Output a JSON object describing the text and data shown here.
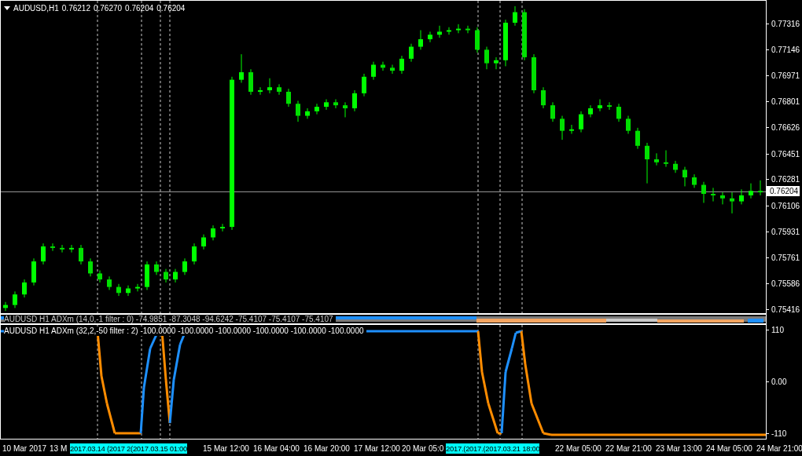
{
  "header": {
    "symbol": "AUDUSD,H1",
    "quotes": [
      "0.76212",
      "0.76270",
      "0.76204",
      "0.76204"
    ]
  },
  "price_chart": {
    "chart_data": {
      "type": "candlestick",
      "ylim": [
        0.75385,
        0.77476
      ],
      "ref_lines": [
        {
          "axis": "y",
          "value": 0.76204,
          "label": "0.76204"
        }
      ],
      "yticks": [
        {
          "value": 0.77316,
          "label": "0.77316"
        },
        {
          "value": 0.77146,
          "label": "0.77146"
        },
        {
          "value": 0.76971,
          "label": "0.76971"
        },
        {
          "value": 0.76801,
          "label": "0.76801"
        },
        {
          "value": 0.76626,
          "label": "0.76626"
        },
        {
          "value": 0.76451,
          "label": "0.76451"
        },
        {
          "value": 0.76281,
          "label": "0.76281"
        },
        {
          "value": 0.76106,
          "label": "0.76106"
        },
        {
          "value": 0.75931,
          "label": "0.75931"
        },
        {
          "value": 0.75761,
          "label": "0.75761"
        },
        {
          "value": 0.75586,
          "label": "0.75586"
        },
        {
          "value": 0.75416,
          "label": "0.75416"
        }
      ],
      "categories": [
        null,
        null,
        null,
        null,
        null,
        null,
        null,
        null,
        null,
        null,
        null,
        null,
        null,
        null,
        null,
        null,
        null,
        null,
        null,
        null,
        null,
        null,
        null,
        null,
        null,
        null,
        null,
        null,
        null,
        null,
        null,
        null,
        null,
        null,
        null,
        null,
        null,
        null,
        null,
        null,
        null,
        null,
        null,
        null,
        null,
        null,
        null,
        null,
        null,
        null,
        null,
        null,
        null,
        null,
        null,
        null,
        null,
        null,
        null,
        null,
        null,
        null,
        null,
        null,
        null,
        null,
        null,
        null,
        null,
        null,
        null,
        null,
        null,
        null,
        null,
        null,
        null,
        null,
        null,
        null,
        null
      ],
      "ohlc": [
        [
          0.7543,
          0.7547,
          0.7541,
          0.7545
        ],
        [
          0.7545,
          0.7554,
          0.7543,
          0.7552
        ],
        [
          0.7552,
          0.7562,
          0.755,
          0.756
        ],
        [
          0.756,
          0.7576,
          0.7558,
          0.7574
        ],
        [
          0.7574,
          0.7586,
          0.7572,
          0.7584
        ],
        [
          0.7584,
          0.7586,
          0.7581,
          0.7583
        ],
        [
          0.7583,
          0.7585,
          0.758,
          0.7582
        ],
        [
          0.7582,
          0.7585,
          0.758,
          0.7583
        ],
        [
          0.7583,
          0.7585,
          0.7572,
          0.7574
        ],
        [
          0.7574,
          0.7576,
          0.7564,
          0.7566
        ],
        [
          0.7566,
          0.7568,
          0.756,
          0.7562
        ],
        [
          0.7562,
          0.7564,
          0.7555,
          0.7557
        ],
        [
          0.7557,
          0.7559,
          0.7551,
          0.7553
        ],
        [
          0.7553,
          0.7558,
          0.7551,
          0.7556
        ],
        [
          0.7556,
          0.7559,
          0.7554,
          0.7557
        ],
        [
          0.7557,
          0.7574,
          0.7555,
          0.7572
        ],
        [
          0.7572,
          0.7574,
          0.7565,
          0.7567
        ],
        [
          0.7567,
          0.7569,
          0.756,
          0.7562
        ],
        [
          0.7562,
          0.7569,
          0.756,
          0.7567
        ],
        [
          0.7567,
          0.7576,
          0.7565,
          0.7574
        ],
        [
          0.7574,
          0.7586,
          0.7572,
          0.7584
        ],
        [
          0.7584,
          0.7592,
          0.7582,
          0.759
        ],
        [
          0.759,
          0.7598,
          0.7588,
          0.7596
        ],
        [
          0.7596,
          0.7599,
          0.7594,
          0.7597
        ],
        [
          0.7597,
          0.7697,
          0.7595,
          0.7695
        ],
        [
          0.7695,
          0.7712,
          0.7693,
          0.77
        ],
        [
          0.77,
          0.7702,
          0.7685,
          0.7687
        ],
        [
          0.7687,
          0.769,
          0.7685,
          0.7688
        ],
        [
          0.7688,
          0.7696,
          0.7686,
          0.769
        ],
        [
          0.769,
          0.7692,
          0.7685,
          0.7687
        ],
        [
          0.7687,
          0.7689,
          0.7677,
          0.7679
        ],
        [
          0.7679,
          0.7681,
          0.7667,
          0.7671
        ],
        [
          0.7671,
          0.7676,
          0.7669,
          0.7674
        ],
        [
          0.7674,
          0.7679,
          0.7672,
          0.7677
        ],
        [
          0.7677,
          0.7682,
          0.7675,
          0.768
        ],
        [
          0.768,
          0.7682,
          0.7676,
          0.7678
        ],
        [
          0.7678,
          0.768,
          0.767,
          0.7676
        ],
        [
          0.7676,
          0.7688,
          0.7674,
          0.7686
        ],
        [
          0.7686,
          0.7699,
          0.7684,
          0.7697
        ],
        [
          0.7697,
          0.7707,
          0.7695,
          0.7705
        ],
        [
          0.7705,
          0.7707,
          0.7701,
          0.7703
        ],
        [
          0.7703,
          0.7705,
          0.7699,
          0.7701
        ],
        [
          0.7701,
          0.7711,
          0.7699,
          0.7709
        ],
        [
          0.7709,
          0.7719,
          0.7707,
          0.7717
        ],
        [
          0.7717,
          0.7728,
          0.7715,
          0.7722
        ],
        [
          0.7722,
          0.7727,
          0.772,
          0.7725
        ],
        [
          0.7725,
          0.7731,
          0.7723,
          0.7727
        ],
        [
          0.7727,
          0.773,
          0.7725,
          0.7728
        ],
        [
          0.7728,
          0.7732,
          0.7726,
          0.7729
        ],
        [
          0.7729,
          0.7731,
          0.7726,
          0.7728
        ],
        [
          0.7728,
          0.773,
          0.7713,
          0.7715
        ],
        [
          0.7715,
          0.7717,
          0.7702,
          0.7706
        ],
        [
          0.7706,
          0.771,
          0.7702,
          0.7708
        ],
        [
          0.7708,
          0.7735,
          0.7704,
          0.7733
        ],
        [
          0.7733,
          0.7744,
          0.7731,
          0.774
        ],
        [
          0.774,
          0.7742,
          0.7708,
          0.771
        ],
        [
          0.771,
          0.7712,
          0.7686,
          0.7688
        ],
        [
          0.7688,
          0.769,
          0.7676,
          0.7678
        ],
        [
          0.7678,
          0.768,
          0.7667,
          0.7669
        ],
        [
          0.7669,
          0.7671,
          0.7655,
          0.7661
        ],
        [
          0.7661,
          0.7665,
          0.7659,
          0.7662
        ],
        [
          0.7662,
          0.7674,
          0.766,
          0.7672
        ],
        [
          0.7672,
          0.7678,
          0.767,
          0.7676
        ],
        [
          0.7676,
          0.7682,
          0.7674,
          0.7678
        ],
        [
          0.7678,
          0.768,
          0.7675,
          0.7677
        ],
        [
          0.7677,
          0.7679,
          0.7667,
          0.7669
        ],
        [
          0.7669,
          0.7671,
          0.7659,
          0.7661
        ],
        [
          0.7661,
          0.7663,
          0.7649,
          0.7651
        ],
        [
          0.7651,
          0.7653,
          0.7626,
          0.7642
        ],
        [
          0.7642,
          0.7646,
          0.7638,
          0.764
        ],
        [
          0.764,
          0.7648,
          0.7637,
          0.7639
        ],
        [
          0.7639,
          0.7641,
          0.7633,
          0.7635
        ],
        [
          0.7635,
          0.7637,
          0.7624,
          0.763
        ],
        [
          0.763,
          0.7632,
          0.7623,
          0.7625
        ],
        [
          0.7625,
          0.7627,
          0.7613,
          0.7619
        ],
        [
          0.7619,
          0.7623,
          0.7614,
          0.7618
        ],
        [
          0.7618,
          0.762,
          0.7612,
          0.7616
        ],
        [
          0.7616,
          0.762,
          0.7606,
          0.7614
        ],
        [
          0.7614,
          0.7622,
          0.7612,
          0.7618
        ],
        [
          0.7618,
          0.7626,
          0.7616,
          0.7621
        ],
        [
          0.7621,
          0.7628,
          0.7618,
          0.762
        ]
      ]
    }
  },
  "strip_indicator": {
    "title": "AUDUSD H1 ADXm (14,0,-1 filter : 0) -74.9851 -87.3048 -94.6242 -75.4107 -75.4107 -75.4107"
  },
  "indicator": {
    "title": "AUDUSD H1 ADXm (32,2,-50 filter : 2) -100.0000 -100.0000 -100.0000 -100.0000 -100.0000 -100.0000",
    "axis_labels": [
      "110",
      "0.00",
      "-110"
    ]
  },
  "time_axis": {
    "labels": [
      "10 Mar 2017",
      "13 M",
      "15 Mar 12:00",
      "16 Mar 04:00",
      "16 Mar 20:00",
      "17 Mar 12:00",
      "20 Mar 05:0",
      "22 Mar 05:00",
      "22 Mar 21:00",
      "23 Mar 13:00",
      "24 Mar 05:00",
      "24 Mar 21:00"
    ],
    "marker_groups": [
      [
        "2017.03.14 (",
        "2017 2(",
        "2017.03.15 01:00"
      ],
      [
        "2017.(",
        "2017.(",
        "2017.03.21 18:00"
      ]
    ]
  }
}
